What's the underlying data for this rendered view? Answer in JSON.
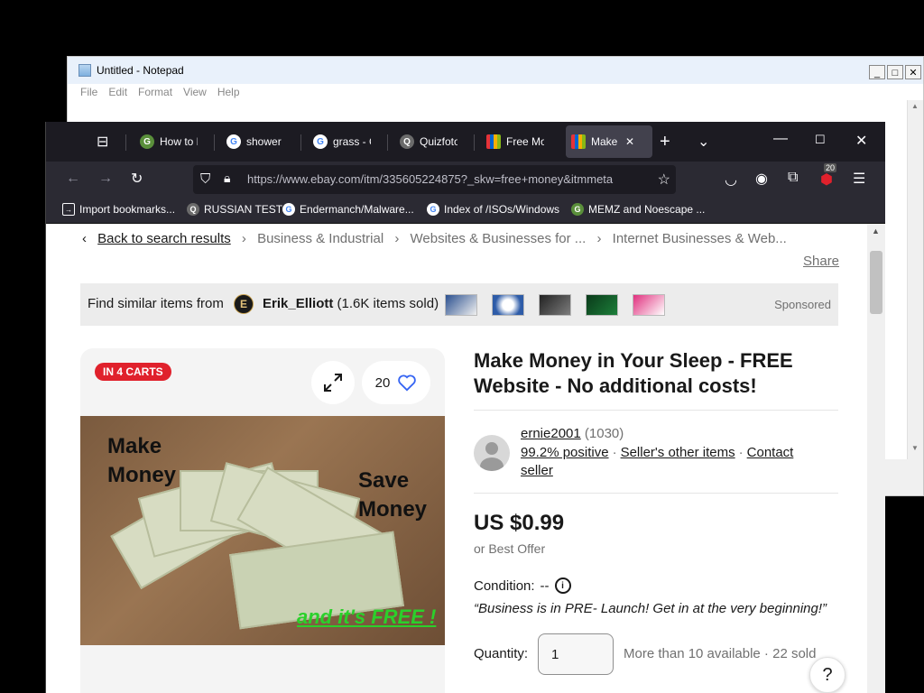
{
  "notepad": {
    "title": "Untitled - Notepad",
    "menu": [
      "File",
      "Edit",
      "Format",
      "View",
      "Help"
    ],
    "buttons": {
      "minimize": "_",
      "maximize": "□",
      "close": "✕"
    }
  },
  "firefox": {
    "tabs": [
      {
        "label": "How to E",
        "icon": "grass-favicon-icon",
        "color": "#5a8f3b"
      },
      {
        "label": "shower -",
        "icon": "google-favicon-icon",
        "color": "#ffffff"
      },
      {
        "label": "grass - G",
        "icon": "google-favicon-icon",
        "color": "#ffffff"
      },
      {
        "label": "Quizfoto",
        "icon": "quizfoto-favicon-icon",
        "color": "#6b6b6b"
      },
      {
        "label": "Free Mon",
        "icon": "ebay-favicon-icon",
        "color": "#e53238"
      },
      {
        "label": "Make I",
        "icon": "ebay-favicon-icon",
        "color": "#e53238",
        "active": true
      }
    ],
    "url": "https://www.ebay.com/itm/335605224875?_skw=free+money&itmmeta",
    "extensions_badge": "20",
    "bookmarks": [
      {
        "label": "Import bookmarks...",
        "icon": "import-icon"
      },
      {
        "label": "RUSSIAN TEST",
        "icon": "quizfoto-favicon-icon"
      },
      {
        "label": "Endermanch/Malware...",
        "icon": "google-favicon-icon"
      },
      {
        "label": "Index of /ISOs/Windows",
        "icon": "google-favicon-icon"
      },
      {
        "label": "MEMZ and Noescape ...",
        "icon": "grass-favicon-icon"
      }
    ]
  },
  "breadcrumb": {
    "back": "Back to search results",
    "items": [
      "Business & Industrial",
      "Websites & Businesses for ...",
      "Internet Businesses & Web..."
    ]
  },
  "share": "Share",
  "sponsored": {
    "text": "Find similar items from",
    "logo_letter": "E",
    "seller": "Erik_Elliott",
    "sold": "(1.6K items sold)",
    "label": "Sponsored"
  },
  "listing": {
    "carts_badge": "IN 4 CARTS",
    "watch_count": "20",
    "image_text": {
      "line1": "Make",
      "line2": "Money",
      "line3": "Save",
      "line4": "Money",
      "line5": "and it's FREE !"
    },
    "title": "Make Money in Your Sleep - FREE Website - No additional costs!",
    "seller": {
      "name": "ernie2001",
      "feedback": "(1030)",
      "positive": "99.2% positive",
      "other_items": "Seller's other items",
      "contact": "Contact seller"
    },
    "price": "US $0.99",
    "best_offer": "or Best Offer",
    "condition_label": "Condition:",
    "condition_value": "--",
    "quote": "“Business is in PRE- Launch! Get in at the very beginning!”",
    "quantity_label": "Quantity:",
    "quantity_value": "1",
    "availability": "More than 10 available · 22 sold",
    "help": "?"
  }
}
